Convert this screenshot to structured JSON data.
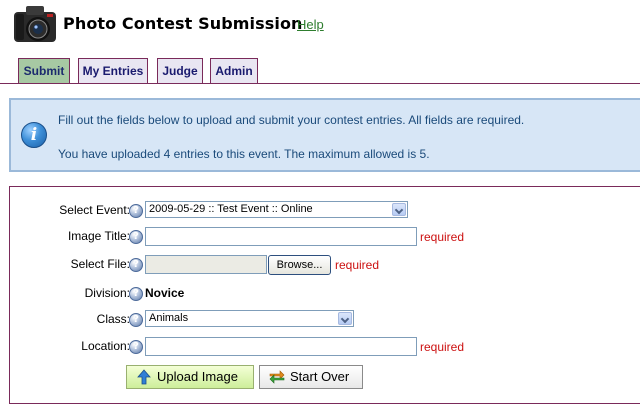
{
  "header": {
    "title": "Photo Contest Submission",
    "help_label": "Help",
    "logo_icon": "camera-icon"
  },
  "tabs": [
    {
      "label": "Submit",
      "active": true
    },
    {
      "label": "My Entries",
      "active": false
    },
    {
      "label": "Judge",
      "active": false
    },
    {
      "label": "Admin",
      "active": false
    }
  ],
  "info": {
    "icon": "info-icon",
    "line1": "Fill out the fields below to upload and submit your contest entries. All fields are required.",
    "line2": "You have uploaded 4 entries to this event. The maximum allowed is 5."
  },
  "form": {
    "event": {
      "label": "Select Event:",
      "value": "2009-05-29 :: Test Event :: Online"
    },
    "image_title": {
      "label": "Image Title:",
      "value": "",
      "required": "required"
    },
    "file": {
      "label": "Select File:",
      "value": "",
      "browse": "Browse...",
      "required": "required"
    },
    "division": {
      "label": "Division:",
      "value": "Novice"
    },
    "class": {
      "label": "Class:",
      "value": "Animals"
    },
    "location": {
      "label": "Location:",
      "value": "",
      "required": "required"
    },
    "upload_label": "Upload Image",
    "startover_label": "Start Over"
  },
  "colors": {
    "tab_border": "#7a2a5a",
    "active_tab": "#a7c9a3",
    "info_bg": "#d7e6f6",
    "required": "#cc1111",
    "help_link": "#2e7d2e"
  }
}
